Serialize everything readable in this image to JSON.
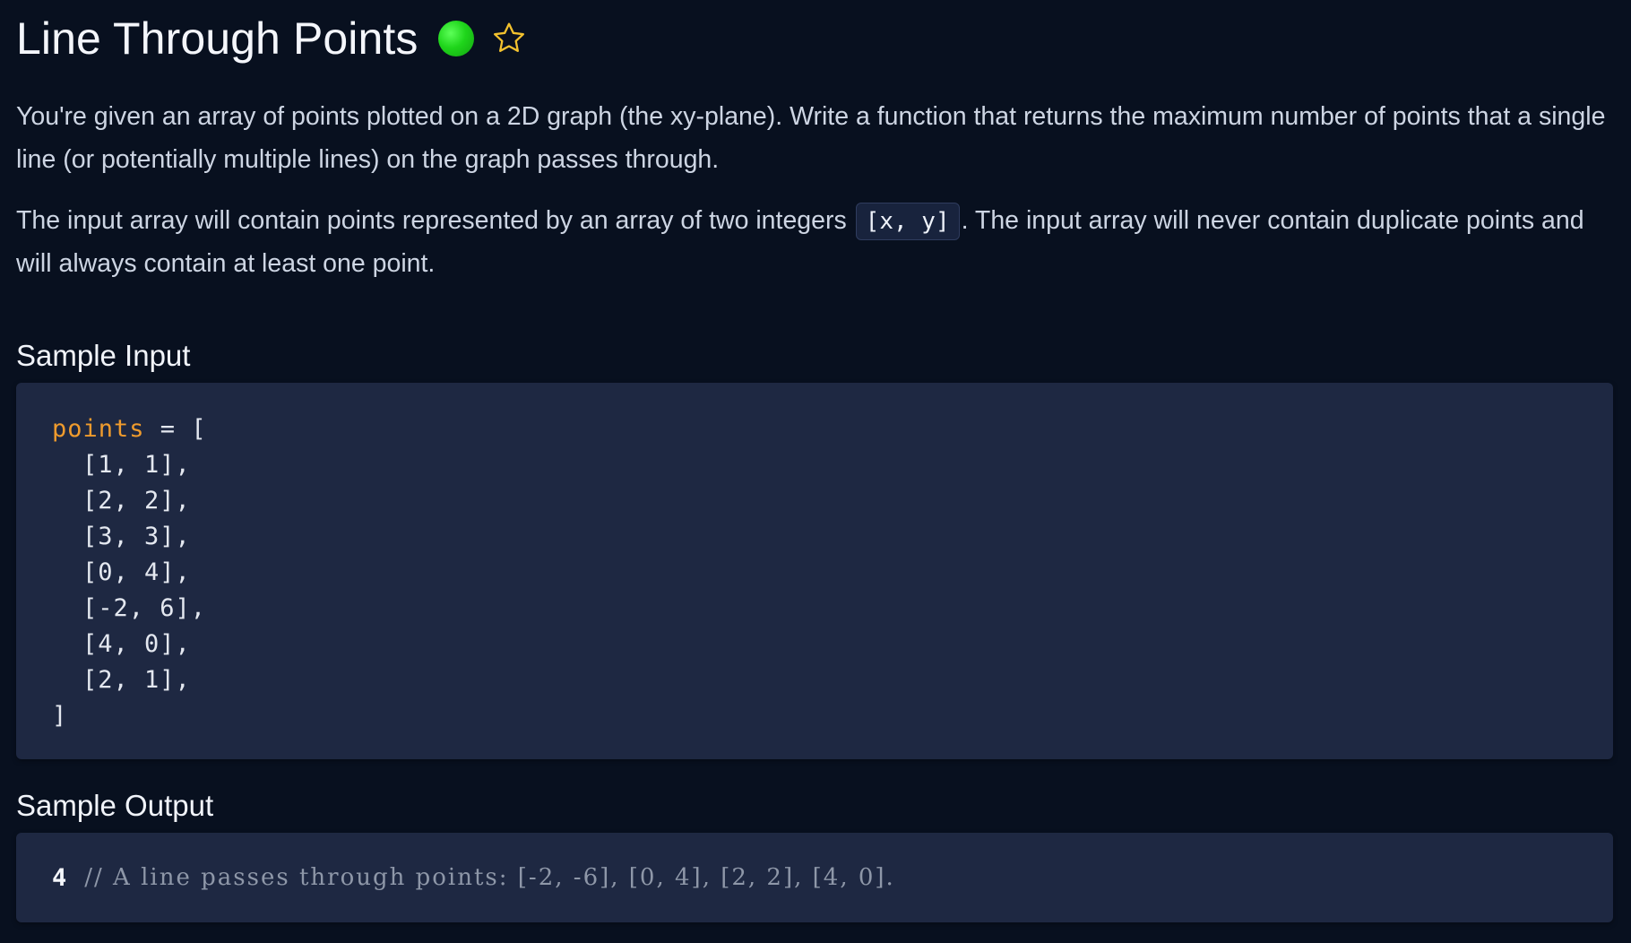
{
  "header": {
    "title": "Line Through Points",
    "status_icon": "green-dot-icon",
    "favorite_icon": "star-outline-icon",
    "status_color": "#1fd51b",
    "star_color": "#f2c12e"
  },
  "description": {
    "paragraph1": "You're given an array of points plotted on a 2D graph (the xy-plane). Write a function that returns the maximum number of points that a single line (or potentially multiple lines) on the graph passes through.",
    "paragraph2_before": "The input array will contain points represented by an array of two integers",
    "paragraph2_code": "[x, y]",
    "paragraph2_after": ". The input array will never contain duplicate points and will always contain at least one point."
  },
  "sample_input": {
    "heading": "Sample Input",
    "var_name": "points",
    "assign": " = [",
    "lines": [
      "[1, 1],",
      "[2, 2],",
      "[3, 3],",
      "[0, 4],",
      "[-2, 6],",
      "[4, 0],",
      "[2, 1],"
    ],
    "closing": "]"
  },
  "sample_output": {
    "heading": "Sample Output",
    "value": "4",
    "comment": "// A line passes through points: [-2, -6], [0, 4], [2, 2], [4, 0]."
  }
}
